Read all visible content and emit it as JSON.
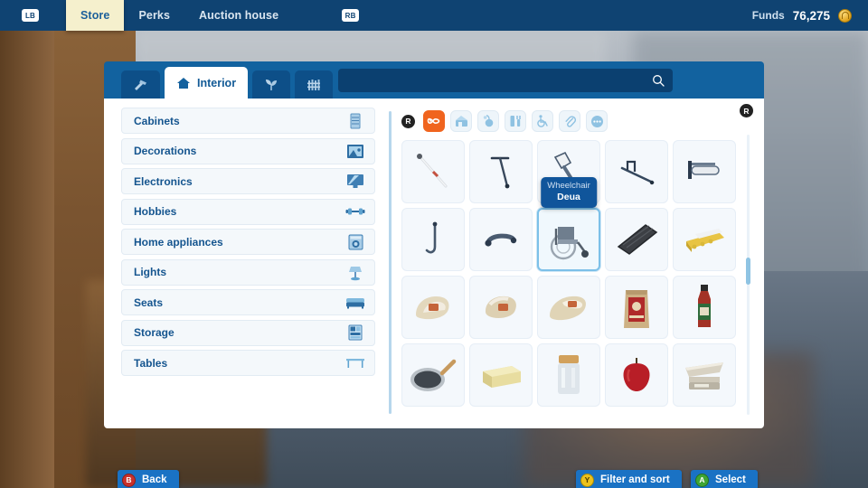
{
  "topbar": {
    "left_bumper": "LB",
    "right_bumper": "RB",
    "nav": [
      {
        "label": "Store",
        "active": true
      },
      {
        "label": "Perks",
        "active": false
      },
      {
        "label": "Auction house",
        "active": false
      }
    ],
    "funds_label": "Funds",
    "funds_value": "76,275",
    "coin_icon": "coin-icon"
  },
  "panel": {
    "tabs": [
      {
        "icon": "hammer-icon",
        "label": "",
        "active": false
      },
      {
        "icon": "house-icon",
        "label": "Interior",
        "active": true
      },
      {
        "icon": "plant-icon",
        "label": "",
        "active": false
      },
      {
        "icon": "fence-icon",
        "label": "",
        "active": false
      }
    ],
    "search": {
      "value": "",
      "placeholder": "",
      "icon": "search-icon"
    }
  },
  "categories": [
    {
      "label": "Cabinets",
      "icon": "cabinet-icon"
    },
    {
      "label": "Decorations",
      "icon": "picture-frame-icon"
    },
    {
      "label": "Electronics",
      "icon": "monitor-icon"
    },
    {
      "label": "Hobbies",
      "icon": "dumbbell-icon"
    },
    {
      "label": "Home appliances",
      "icon": "washing-machine-icon"
    },
    {
      "label": "Lights",
      "icon": "lamp-icon"
    },
    {
      "label": "Seats",
      "icon": "armchair-icon"
    },
    {
      "label": "Storage",
      "icon": "shelf-icon"
    },
    {
      "label": "Tables",
      "icon": "table-icon"
    }
  ],
  "filters": {
    "stick_badge": "R",
    "buttons": [
      {
        "icon": "infinity-icon",
        "active": true
      },
      {
        "icon": "furniture-icon",
        "active": false
      },
      {
        "icon": "food-icon",
        "active": false
      },
      {
        "icon": "tools-icon",
        "active": false
      },
      {
        "icon": "wheelchair-icon",
        "active": false
      },
      {
        "icon": "paperclip-icon",
        "active": false
      },
      {
        "icon": "more-dots-icon",
        "active": false
      }
    ]
  },
  "grid": {
    "stick_badge": "R",
    "items": [
      {
        "icon": "cane-white-icon",
        "selected": false
      },
      {
        "icon": "walking-cane-icon",
        "selected": false
      },
      {
        "icon": "crutch-icon",
        "selected": false,
        "tooltip": {
          "name": "Wheelchair",
          "brand": "Deua"
        }
      },
      {
        "icon": "grab-bar-angled-icon",
        "selected": false
      },
      {
        "icon": "handrail-icon",
        "selected": false
      },
      {
        "icon": "shower-rail-icon",
        "selected": false
      },
      {
        "icon": "grab-bar-icon",
        "selected": false
      },
      {
        "icon": "wheelchair-item-icon",
        "selected": true
      },
      {
        "icon": "ramp-icon",
        "selected": false
      },
      {
        "icon": "yellow-bench-icon",
        "selected": false
      },
      {
        "icon": "slipper-a-icon",
        "selected": false
      },
      {
        "icon": "slipper-b-icon",
        "selected": false
      },
      {
        "icon": "sandal-icon",
        "selected": false
      },
      {
        "icon": "flour-bag-icon",
        "selected": false
      },
      {
        "icon": "sauce-bottle-icon",
        "selected": false
      },
      {
        "icon": "frying-pan-icon",
        "selected": false
      },
      {
        "icon": "butter-block-icon",
        "selected": false
      },
      {
        "icon": "glass-jar-icon",
        "selected": false
      },
      {
        "icon": "apple-icon",
        "selected": false
      },
      {
        "icon": "kitchen-scale-icon",
        "selected": false
      }
    ]
  },
  "footer": {
    "back": {
      "pad": "B",
      "label": "Back"
    },
    "filter_sort": {
      "pad": "Y",
      "label": "Filter and sort"
    },
    "select": {
      "pad": "A",
      "label": "Select"
    }
  }
}
